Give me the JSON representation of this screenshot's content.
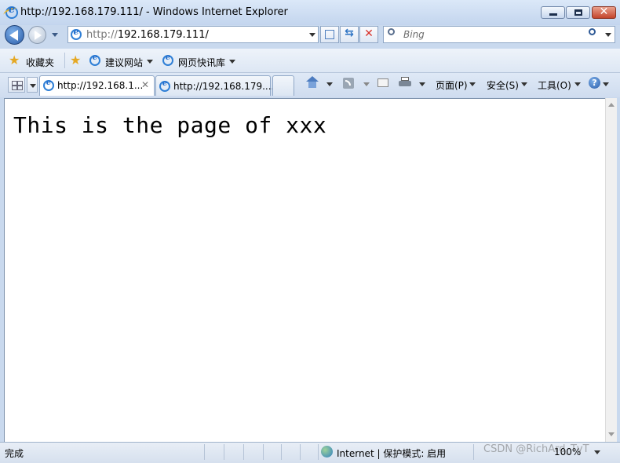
{
  "window": {
    "title": "http://192.168.179.111/ - Windows Internet Explorer"
  },
  "address_bar": {
    "value_prefix": "http://",
    "value_host": "192.168.179.111/"
  },
  "search": {
    "placeholder": "Bing"
  },
  "favorites_bar": {
    "favorites_label": "收藏夹",
    "suggested_sites_label": "建议网站",
    "web_slice_label": "网页快讯库"
  },
  "tabs": [
    {
      "label": "http://192.168.1...",
      "active": true
    },
    {
      "label": "http://192.168.179....",
      "active": false
    }
  ],
  "command_bar": {
    "page_label": "页面(P)",
    "safety_label": "安全(S)",
    "tools_label": "工具(O)"
  },
  "content": {
    "heading": "This is the page of xxx"
  },
  "status_bar": {
    "status_text": "完成",
    "zone_label": "Internet | 保护模式: 启用",
    "zoom_label": "100%",
    "watermark": "CSDN @RichArd_TvT"
  },
  "colors": {
    "frame": "#c9d9ee",
    "close_button": "#c4452c",
    "back_button": "#2a5ca8",
    "stop_icon": "#d8322a"
  }
}
